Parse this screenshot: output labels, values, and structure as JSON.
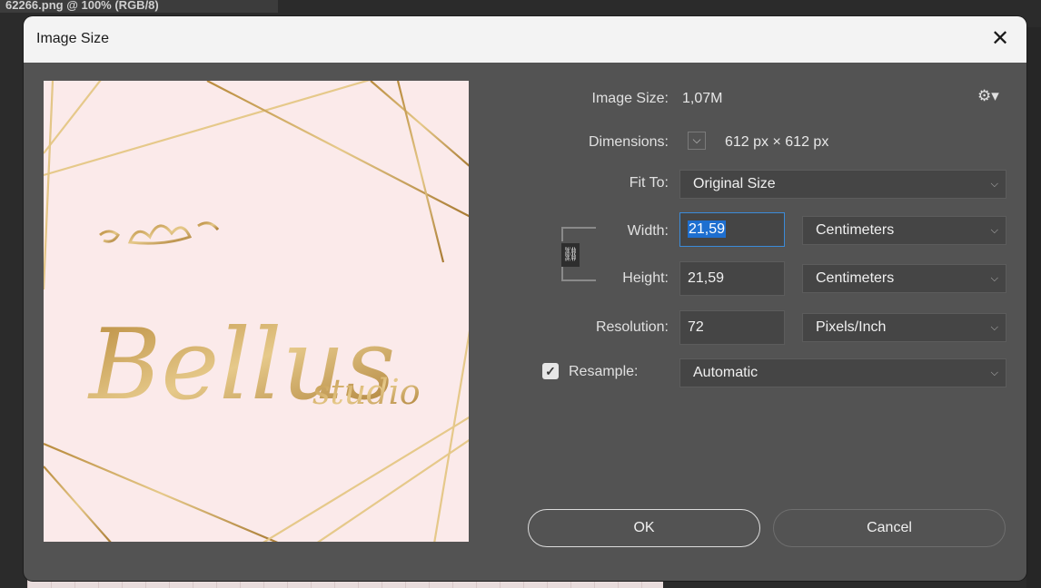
{
  "background": {
    "document_tab": "62266.png @ 100% (RGB/8)"
  },
  "dialog": {
    "title": "Image Size",
    "close_icon": "close-icon",
    "preview": {
      "script": "Bellus",
      "subtitle": "studio"
    },
    "image_size": {
      "label": "Image Size:",
      "value": "1,07M",
      "settings_icon": "gear-icon"
    },
    "dimensions": {
      "label": "Dimensions:",
      "value": "612 px  ×  612 px"
    },
    "fit_to": {
      "label": "Fit To:",
      "value": "Original Size"
    },
    "width": {
      "label": "Width:",
      "value": "21,59",
      "unit": "Centimeters"
    },
    "height": {
      "label": "Height:",
      "value": "21,59",
      "unit": "Centimeters"
    },
    "resolution": {
      "label": "Resolution:",
      "value": "72",
      "unit": "Pixels/Inch"
    },
    "resample": {
      "label": "Resample:",
      "checked": true,
      "value": "Automatic"
    },
    "buttons": {
      "ok": "OK",
      "cancel": "Cancel"
    }
  },
  "colors": {
    "dialog_bg": "#535353",
    "titlebar_bg": "#f3f3f3",
    "preview_bg": "#fbeaea",
    "gold": "#c9a35a",
    "selection": "#1e6fd0"
  }
}
